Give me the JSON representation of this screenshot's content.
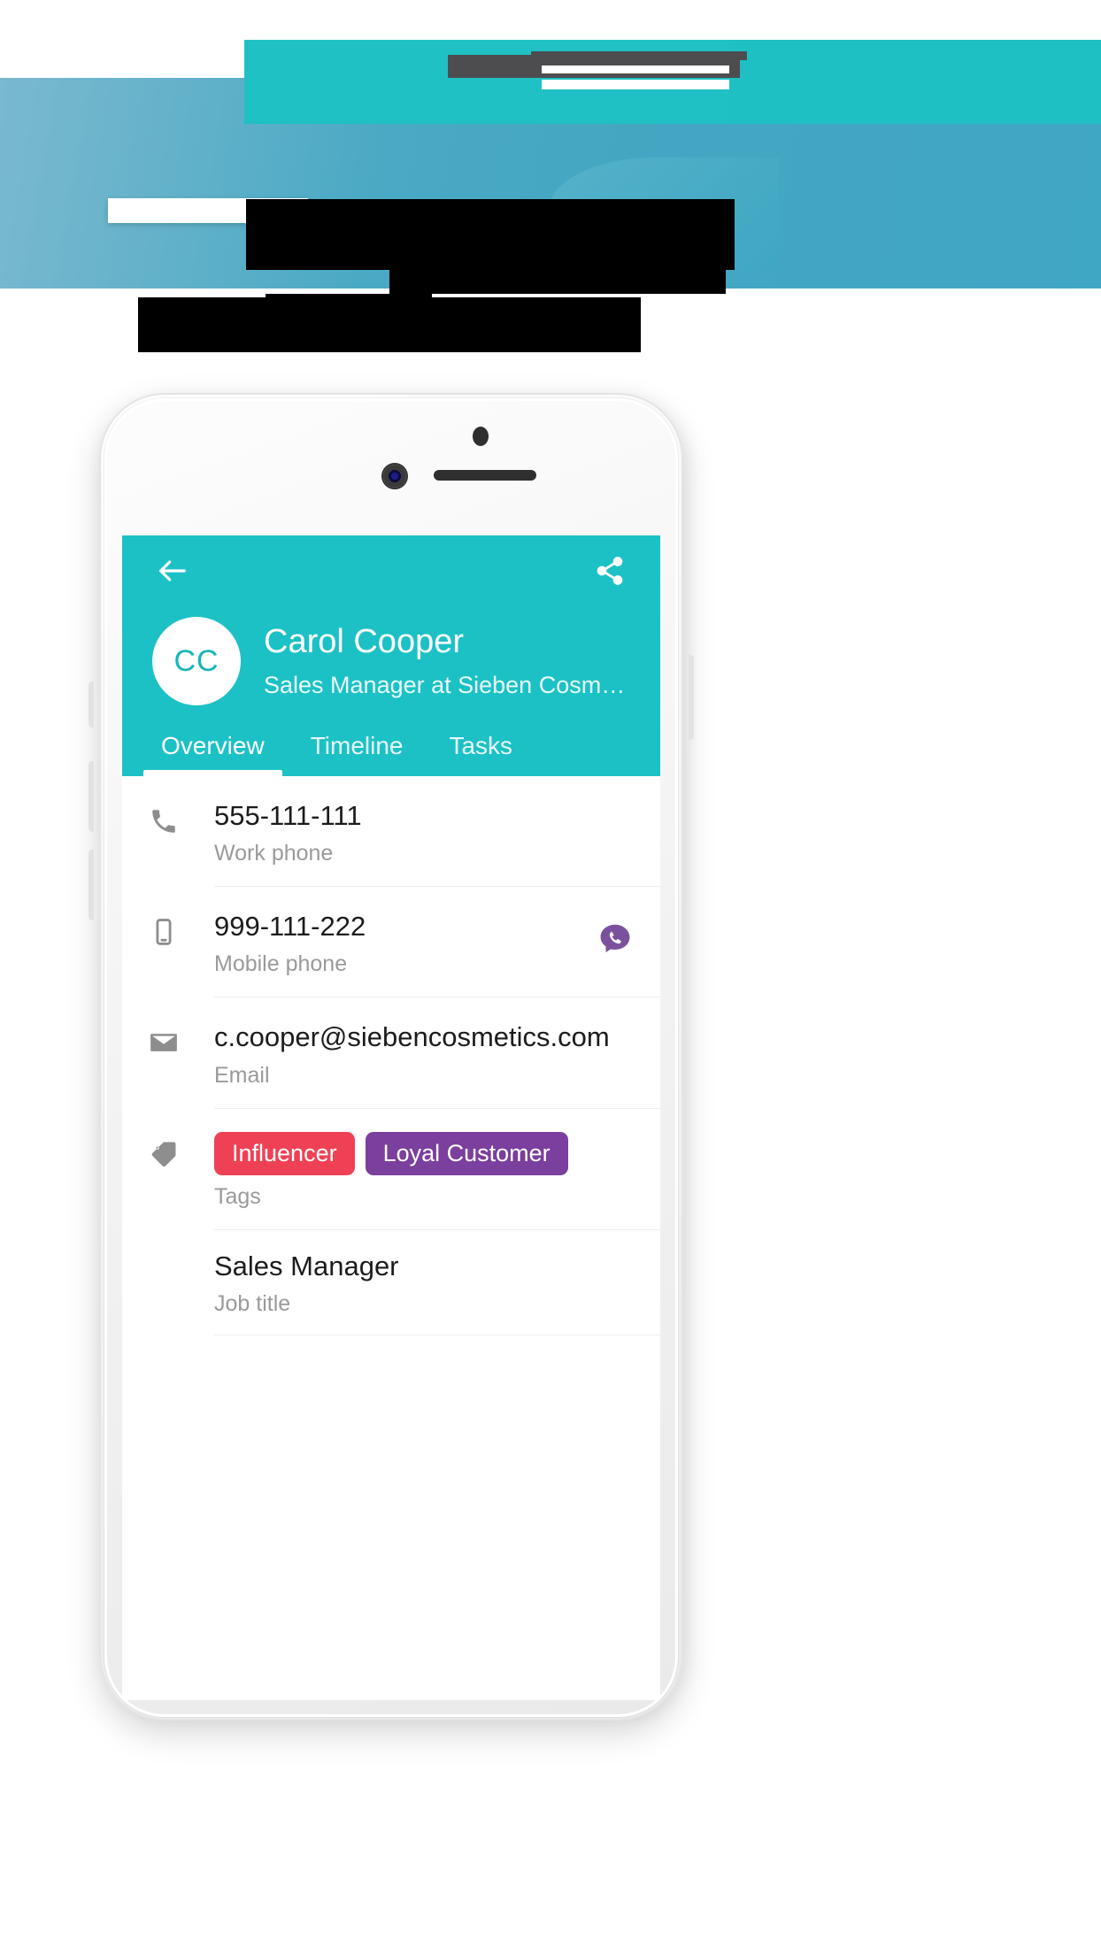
{
  "colors": {
    "brand_teal": "#1cc1c6",
    "banner_blue": "#4aa9c4",
    "tag_influencer": "#ef4155",
    "tag_loyal": "#7b3f9d",
    "viber_purple": "#7b519d",
    "icon_grey": "#8e8e8e",
    "label_grey": "#9a9a9a"
  },
  "banner": {
    "note": "redacted-blurred-marketing-banner"
  },
  "phone": {
    "hardware": {
      "speaker": "earpiece-speaker",
      "front_camera": "front-camera",
      "proximity_sensor": "proximity-sensor"
    }
  },
  "app": {
    "header": {
      "back_icon": "arrow-left-icon",
      "share_icon": "share-icon"
    },
    "contact": {
      "initials": "CC",
      "name": "Carol Cooper",
      "subtitle": "Sales Manager at Sieben Cosme..."
    },
    "tabs": [
      {
        "label": "Overview",
        "active": true
      },
      {
        "label": "Timeline",
        "active": false
      },
      {
        "label": "Tasks",
        "active": false
      }
    ],
    "details": [
      {
        "icon": "phone-icon",
        "value": "555-111-111",
        "label": "Work phone",
        "action": null
      },
      {
        "icon": "mobile-icon",
        "value": "999-111-222",
        "label": "Mobile phone",
        "action": "viber-icon"
      },
      {
        "icon": "mail-icon",
        "value": "c.cooper@siebencosmetics.com",
        "label": "Email",
        "action": null
      }
    ],
    "tags_row": {
      "icon": "tag-icon",
      "label": "Tags",
      "tags": [
        {
          "text": "Influencer",
          "color": "#ef4155"
        },
        {
          "text": "Loyal Customer",
          "color": "#7b3f9d"
        }
      ]
    },
    "job_row": {
      "value": "Sales Manager",
      "label": "Job title"
    }
  }
}
